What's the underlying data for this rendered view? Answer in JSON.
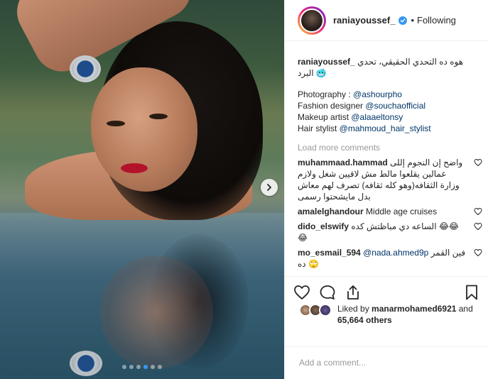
{
  "post": {
    "username": "raniayoussef_",
    "separator": "•",
    "follow_status": "Following",
    "caption_user": "raniayoussef_",
    "caption_text": "هوه ده التحدي الحقيقي، تحدي البرد 🥶",
    "credits": [
      {
        "label": "Photography : ",
        "mention": "@ashourpho"
      },
      {
        "label": "Fashion designer ",
        "mention": "@souchaofficial"
      },
      {
        "label": "Makeup artist ",
        "mention": "@alaaeltonsy"
      },
      {
        "label": "Hair stylist ",
        "mention": "@mahmoud_hair_stylist"
      }
    ],
    "load_more": "Load more comments",
    "comments": [
      {
        "user": "muhammaad.hammad",
        "text": "واضح إن النجوم إللى عمالين يقلعوا مالط مش لاقيين شغل ولازم وزارة الثقافه(وهو كله ثقافه) تصرف لهم معاش بدل مايشحتوا رسمى"
      },
      {
        "user": "amalelghandour",
        "text": "Middle age cruises"
      },
      {
        "user": "dido_elswify",
        "text": "الساعه دي مباظتش كده 😂😂😂"
      },
      {
        "user": "mo_esmail_594",
        "mention": "@nada.ahmed9p",
        "text": "فين القمر ده 🙄"
      }
    ],
    "likes_prefix": "Liked by ",
    "likes_user": "manarmohamed6921",
    "likes_and": " and",
    "likes_others": "65,664 others",
    "add_comment_placeholder": "Add a comment...",
    "carousel_dots": 6,
    "carousel_active_index": 3
  },
  "colors": {
    "accent": "#3897f0",
    "mention": "#003569",
    "muted": "#999999",
    "text": "#262626"
  },
  "icons": [
    "verified-badge-icon",
    "chevron-right-icon",
    "heart-icon",
    "comment-icon",
    "share-icon",
    "bookmark-icon"
  ]
}
